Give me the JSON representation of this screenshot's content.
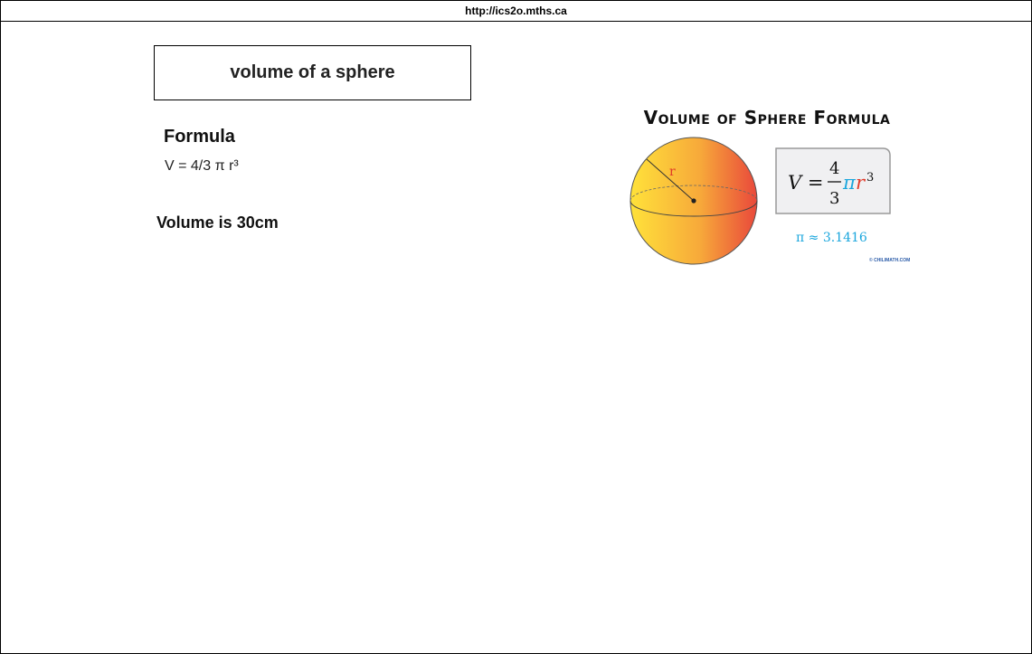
{
  "browser": {
    "url": "http://ics2o.mths.ca"
  },
  "main": {
    "title": "volume of a sphere",
    "formula_heading": "Formula",
    "formula": "V = 4/3 π r³",
    "result": "Volume is 30cm"
  },
  "figure": {
    "title": "Volume of Sphere Formula",
    "radius_label": "r",
    "formula_v": "V =",
    "formula_num": "4",
    "formula_den": "3",
    "formula_pi": "π",
    "formula_r": "r",
    "formula_exp": "3",
    "pi_approx": "π ≈ 3.1416",
    "credit": "© CHILIMATH.COM",
    "colors": {
      "sphere_left": "#ffe23a",
      "sphere_mid": "#f7a93a",
      "sphere_right": "#e9483b",
      "radius_label": "#e03a2a",
      "pi_blue": "#1aa6dd",
      "box_fill": "#f0f0f2",
      "box_border": "#999999"
    }
  }
}
